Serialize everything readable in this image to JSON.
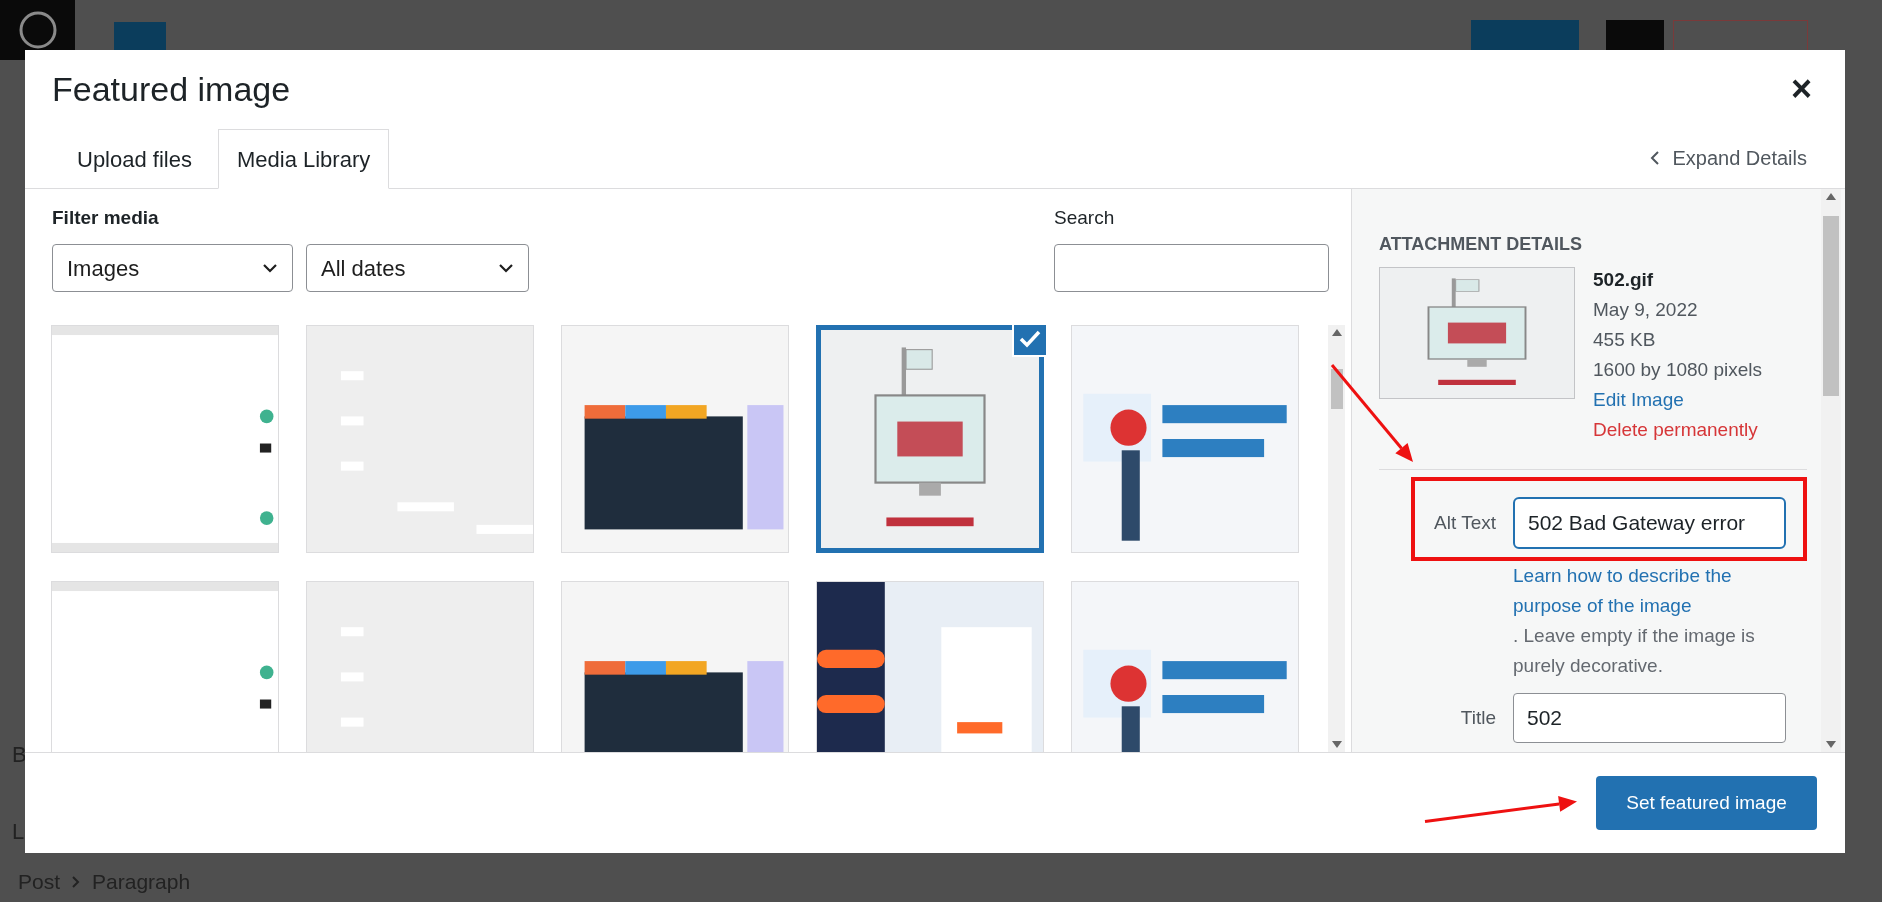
{
  "editor": {
    "background_texts": [
      "B",
      "L"
    ],
    "breadcrumb": [
      "Post",
      "Paragraph"
    ]
  },
  "modal": {
    "title": "Featured image",
    "close": "×",
    "tabs": [
      {
        "label": "Upload files",
        "selected": false
      },
      {
        "label": "Media Library",
        "selected": true
      }
    ],
    "expand_details": "Expand Details",
    "filter": {
      "label": "Filter media",
      "type_select": "Images",
      "date_select": "All dates"
    },
    "search": {
      "label": "Search"
    },
    "media_items": [
      {
        "kind": "picture",
        "selected": false
      },
      {
        "kind": "picture",
        "selected": false
      },
      {
        "kind": "picture",
        "selected": false
      },
      {
        "kind": "picture",
        "selected": true
      },
      {
        "kind": "picture",
        "selected": false
      },
      {
        "kind": "picture",
        "selected": false
      },
      {
        "kind": "picture",
        "selected": false
      },
      {
        "kind": "picture",
        "selected": false
      },
      {
        "kind": "picture",
        "selected": false
      },
      {
        "kind": "picture",
        "selected": false
      }
    ],
    "details": {
      "heading": "ATTACHMENT DETAILS",
      "filename": "502.gif",
      "date": "May 9, 2022",
      "size": "455 KB",
      "dimensions": "1600 by 1080 pixels",
      "edit_link": "Edit Image",
      "delete_link": "Delete permanently",
      "alt_text": {
        "label": "Alt Text",
        "value": "502 Bad Gateway error",
        "help_link": "Learn how to describe the purpose of the image",
        "help_rest": ". Leave empty if the image is purely decorative."
      },
      "title_field": {
        "label": "Title",
        "value": "502"
      }
    },
    "primary_button": "Set featured image"
  }
}
